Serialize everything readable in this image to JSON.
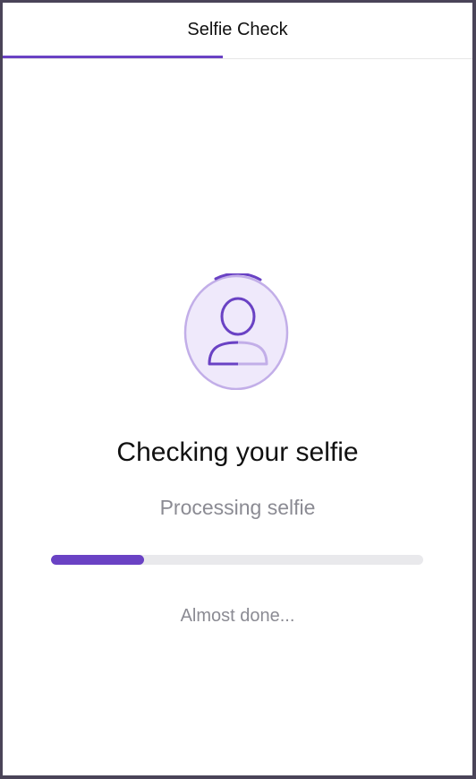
{
  "header": {
    "title": "Selfie Check",
    "step_progress": 0.47
  },
  "status": {
    "icon": "user-scan-icon",
    "heading": "Checking your selfie",
    "subheading": "Processing selfie",
    "progress": 0.25,
    "hint": "Almost done..."
  },
  "colors": {
    "accent": "#6a42c4",
    "accent_light": "#efe9fb",
    "track": "#e9e9ec",
    "muted_text": "#8b8b93"
  }
}
